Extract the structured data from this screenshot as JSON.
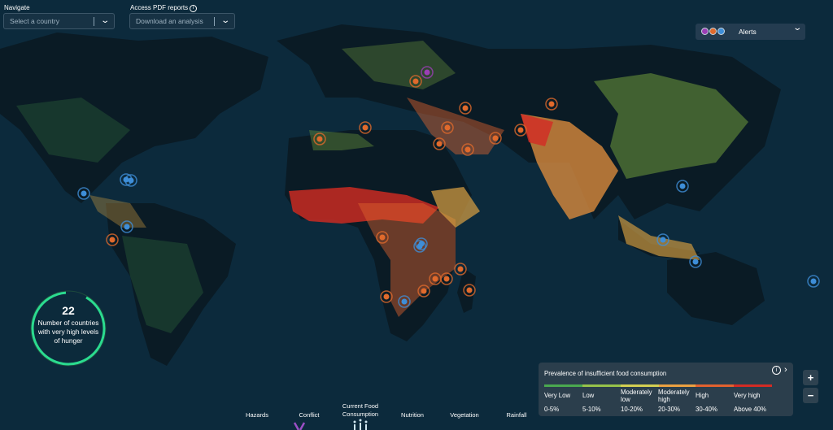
{
  "navigate": {
    "label": "Navigate",
    "placeholder": "Select a country",
    "chevron_icon": "chevron-down-icon"
  },
  "pdf_reports": {
    "label": "Access PDF reports",
    "placeholder": "Download an analysis",
    "info_icon": "info-icon"
  },
  "alerts": {
    "label": "Alerts",
    "dot_colors": [
      "#9b3fb5",
      "#e06a2c",
      "#3e8ed8"
    ]
  },
  "counter": {
    "value": "22",
    "text": "Number of countries with very high levels of hunger",
    "ring_color": "#2bdb8f"
  },
  "legend": {
    "title": "Prevalence of insufficient food consumption",
    "categories": [
      {
        "label": "Very Low",
        "range": "0-5%",
        "color": "#4aa84f"
      },
      {
        "label": "Low",
        "range": "5-10%",
        "color": "#97c24a"
      },
      {
        "label": "Moderately low",
        "range": "10-20%",
        "color": "#d3cf52"
      },
      {
        "label": "Moderately high",
        "range": "20-30%",
        "color": "#eba041"
      },
      {
        "label": "High",
        "range": "30-40%",
        "color": "#e2612f"
      },
      {
        "label": "Very high",
        "range": "Above 40%",
        "color": "#d32b24"
      }
    ]
  },
  "zoom": {
    "in": "+",
    "out": "−"
  },
  "bottom_tabs": [
    "Hazards",
    "Conflict",
    "Current Food Consumption",
    "Nutrition",
    "Vegetation",
    "Rainfall"
  ],
  "alert_colors": {
    "orange": "#e06a2c",
    "blue": "#3e8ed8",
    "purple": "#9b3fb5"
  }
}
